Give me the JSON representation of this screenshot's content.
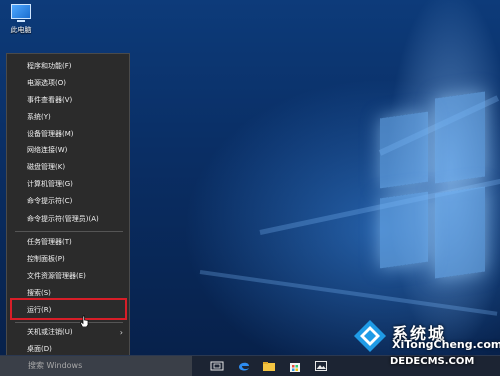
{
  "desktop": {
    "icon_label": "此电脑"
  },
  "context_menu": {
    "groups": [
      [
        {
          "label": "程序和功能(F)"
        },
        {
          "label": "电源选项(O)"
        },
        {
          "label": "事件查看器(V)"
        },
        {
          "label": "系统(Y)"
        },
        {
          "label": "设备管理器(M)"
        },
        {
          "label": "网络连接(W)"
        },
        {
          "label": "磁盘管理(K)"
        },
        {
          "label": "计算机管理(G)"
        },
        {
          "label": "命令提示符(C)"
        },
        {
          "label": "命令提示符(管理员)(A)"
        }
      ],
      [
        {
          "label": "任务管理器(T)"
        },
        {
          "label": "控制面板(P)"
        },
        {
          "label": "文件资源管理器(E)"
        },
        {
          "label": "搜索(S)"
        },
        {
          "label": "运行(R)"
        }
      ],
      [
        {
          "label": "关机或注销(U)",
          "submenu_icon": "chevron-right-icon"
        },
        {
          "label": "桌面(D)"
        }
      ]
    ],
    "highlighted_item": "运行(R)"
  },
  "taskbar": {
    "search_placeholder": "搜索 Windows",
    "icons": [
      "task-view-icon",
      "edge-icon",
      "file-explorer-icon",
      "store-icon",
      "photos-icon"
    ]
  },
  "watermark": {
    "brand": "系统城",
    "tagline": "XiTongCheng.com",
    "url": "DEDECMS.COM"
  },
  "colors": {
    "menu_bg": "#2b2b2b",
    "highlight_border": "#d81e28",
    "taskbar_bg": "#1c2433"
  }
}
